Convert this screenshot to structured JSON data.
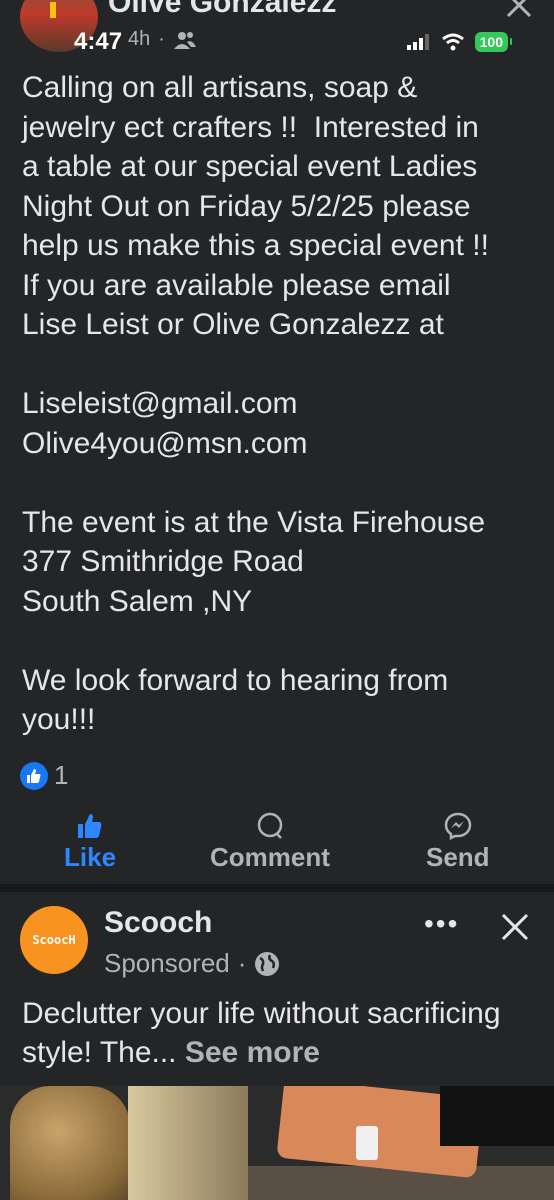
{
  "status_bar": {
    "time": "4:47",
    "battery": "100"
  },
  "post": {
    "author": "Olive Gonzalezz",
    "time_ago": "4h",
    "body": "Calling on all artisans, soap &\njewelry ect crafters !!  Interested in\na table at our special event Ladies\nNight Out on Friday 5/2/25 please\nhelp us make this a special event !!\nIf you are available please email\nLise Leist or Olive Gonzalezz at\n\nLiseleist@gmail.com\nOlive4you@msn.com\n\nThe event is at the Vista Firehouse\n377 Smithridge Road\nSouth Salem ,NY\n\nWe look forward to hearing from\nyou!!!",
    "reaction_count": "1",
    "actions": {
      "like": "Like",
      "comment": "Comment",
      "send": "Send"
    }
  },
  "sponsored": {
    "logo_text": "ScoocH",
    "name": "Scooch",
    "label": "Sponsored",
    "more": "•••",
    "text": "Declutter your life without sacrificing style! The...",
    "see_more": "See more"
  },
  "colors": {
    "background": "#242526",
    "like_blue": "#2d88ff",
    "scooch_orange": "#f7931e",
    "battery_green": "#34c759"
  }
}
